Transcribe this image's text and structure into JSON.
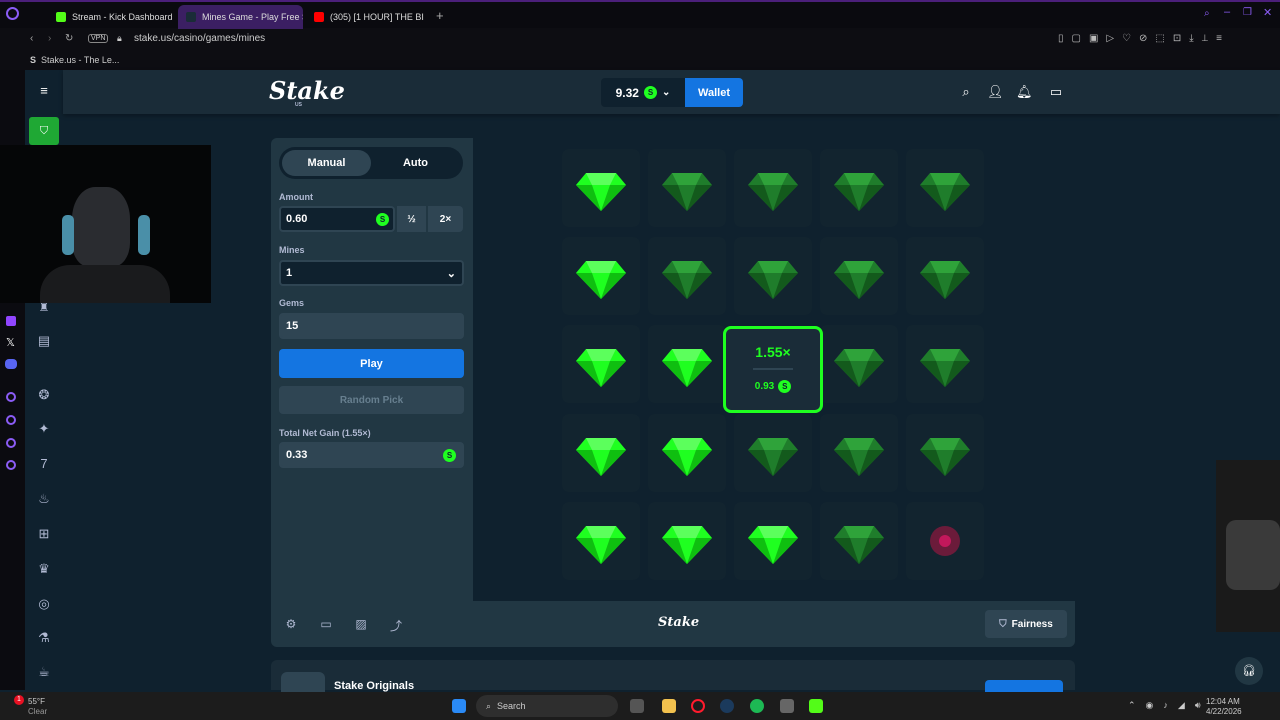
{
  "browser": {
    "tabs": [
      {
        "label": "Stream - Kick Dashboard"
      },
      {
        "label": "Mines Game - Play Free S"
      },
      {
        "label": "(305) [1 HOUR] THE BI"
      }
    ],
    "url": "stake.us/casino/games/mines",
    "vpn_badge": "VPN",
    "bookmark": "Stake.us - The Le..."
  },
  "header": {
    "logo": "Stake",
    "logo_sub": "US",
    "balance": "9.32",
    "coin_symbol": "S",
    "wallet_label": "Wallet"
  },
  "controls": {
    "tab_manual": "Manual",
    "tab_auto": "Auto",
    "amount_label": "Amount",
    "amount_value": "0.60",
    "half_label": "½",
    "double_label": "2×",
    "mines_label": "Mines",
    "mines_value": "1",
    "gems_label": "Gems",
    "gems_value": "15",
    "play_label": "Play",
    "random_label": "Random Pick",
    "gain_label": "Total Net Gain (1.55×)",
    "gain_value": "0.33"
  },
  "board": {
    "rows": 5,
    "cols": 5,
    "revealed": [
      [
        0,
        0
      ],
      [
        1,
        0
      ],
      [
        2,
        0
      ],
      [
        2,
        1
      ],
      [
        3,
        0
      ],
      [
        3,
        1
      ],
      [
        4,
        0
      ],
      [
        4,
        1
      ],
      [
        4,
        2
      ]
    ],
    "mine": [
      4,
      4
    ],
    "cashout_cell": [
      2,
      2
    ],
    "cashout_multiplier": "1.55×",
    "cashout_amount": "0.93"
  },
  "footer": {
    "logo": "Stake",
    "fairness_label": "Fairness"
  },
  "originals": {
    "title": "Stake Originals"
  },
  "taskbar": {
    "weather_temp": "55°F",
    "weather_desc": "Clear",
    "search_placeholder": "Search",
    "time": "12:04 AM",
    "date": "4/22/2026",
    "notification_count": "1"
  },
  "colors": {
    "bg": "#0f212e",
    "panel": "#213743",
    "accent_green": "#1fff20",
    "accent_blue": "#1475e1"
  }
}
